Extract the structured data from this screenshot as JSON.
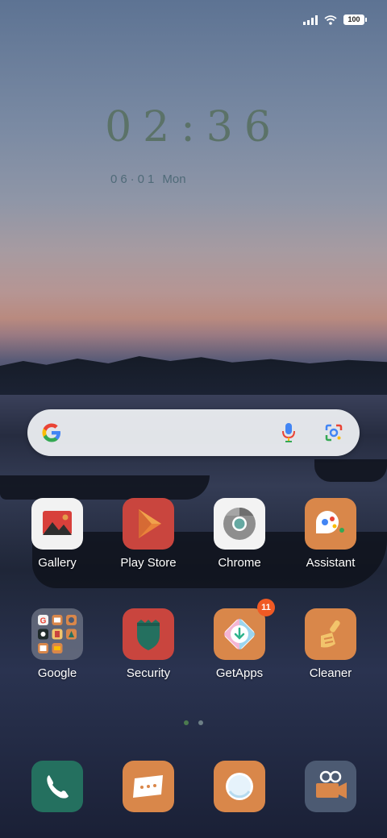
{
  "status_bar": {
    "battery": "100"
  },
  "lockclock": {
    "time": "02:36",
    "date": "06·01",
    "weekday": "Mon"
  },
  "apps_row1": [
    {
      "label": "Gallery",
      "icon": "gallery-icon"
    },
    {
      "label": "Play Store",
      "icon": "play-store-icon"
    },
    {
      "label": "Chrome",
      "icon": "chrome-icon"
    },
    {
      "label": "Assistant",
      "icon": "assistant-icon"
    }
  ],
  "apps_row2": [
    {
      "label": "Google",
      "icon": "google-folder-icon"
    },
    {
      "label": "Security",
      "icon": "security-icon"
    },
    {
      "label": "GetApps",
      "icon": "getapps-icon",
      "badge": "11"
    },
    {
      "label": "Cleaner",
      "icon": "cleaner-icon"
    }
  ],
  "dock": [
    "phone-icon",
    "messages-icon",
    "browser-icon",
    "camera-icon"
  ],
  "colors": {
    "tile_orange": "#d9874a",
    "tile_red": "#c9453e",
    "tile_teal": "#24705f",
    "tile_slate": "#4c5a72",
    "badge": "#f05a24"
  }
}
